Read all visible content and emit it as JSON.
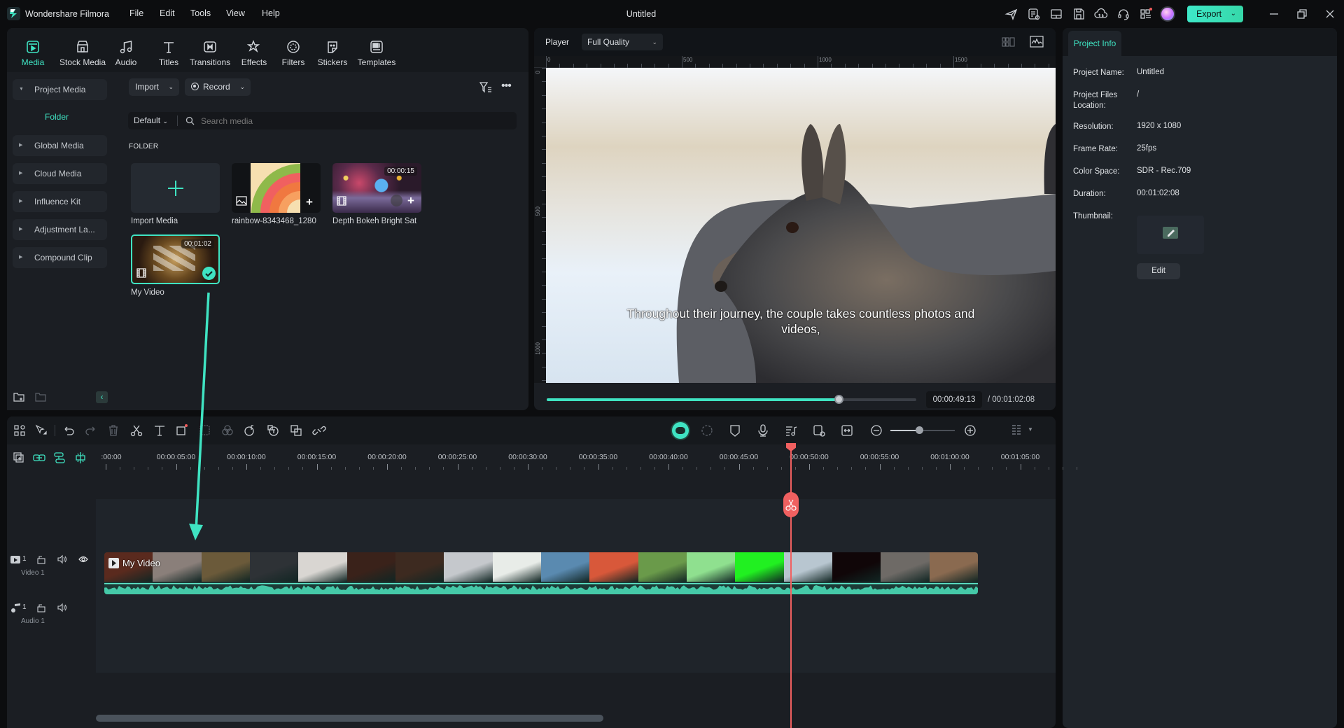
{
  "app": {
    "name": "Wondershare Filmora",
    "document_title": "Untitled",
    "menu": [
      "File",
      "Edit",
      "Tools",
      "View",
      "Help"
    ],
    "title_icons": [
      "send-feedback-icon",
      "task-list-icon",
      "layout-icon",
      "save-icon",
      "cloud-upload-icon",
      "support-headset-icon",
      "apps-grid-icon",
      "user-avatar"
    ],
    "export_label": "Export",
    "accent": "#3fe3c2",
    "playhead_color": "#f06060"
  },
  "media_tabs": [
    {
      "label": "Media",
      "icon": "media-icon",
      "active": true
    },
    {
      "label": "Stock Media",
      "icon": "stock-media-icon",
      "active": false
    },
    {
      "label": "Audio",
      "icon": "audio-icon",
      "active": false
    },
    {
      "label": "Titles",
      "icon": "titles-icon",
      "active": false
    },
    {
      "label": "Transitions",
      "icon": "transitions-icon",
      "active": false
    },
    {
      "label": "Effects",
      "icon": "effects-icon",
      "active": false
    },
    {
      "label": "Filters",
      "icon": "filters-icon",
      "active": false
    },
    {
      "label": "Stickers",
      "icon": "stickers-icon",
      "active": false
    },
    {
      "label": "Templates",
      "icon": "templates-icon",
      "active": false
    }
  ],
  "sidebar": {
    "items": [
      {
        "label": "Project Media",
        "expanded": true
      },
      {
        "label": "Global Media",
        "expanded": false
      },
      {
        "label": "Cloud Media",
        "expanded": false
      },
      {
        "label": "Influence Kit",
        "expanded": false
      },
      {
        "label": "Adjustment La...",
        "expanded": false
      },
      {
        "label": "Compound Clip",
        "expanded": false
      }
    ],
    "folder_label": "Folder"
  },
  "media": {
    "import_label": "Import",
    "record_label": "Record",
    "sort_label": "Default",
    "search_placeholder": "Search media",
    "section_header": "FOLDER",
    "items": [
      {
        "name": "Import Media",
        "type": "import"
      },
      {
        "name": "rainbow-8343468_1280",
        "type": "image"
      },
      {
        "name": "Depth Bokeh Bright Sat",
        "type": "video",
        "duration": "00:00:15"
      },
      {
        "name": "My Video",
        "type": "video",
        "duration": "00:01:02",
        "selected": true
      }
    ]
  },
  "player": {
    "label": "Player",
    "quality": "Full Quality",
    "ruler_h": [
      "0",
      "500",
      "1000",
      "1500"
    ],
    "ruler_v": [
      "0",
      "500",
      "1000"
    ],
    "subtitle_line1": "Throughout their journey, the couple takes countless photos and",
    "subtitle_line2": "videos,",
    "current_time": "00:00:49:13",
    "total_time": "/ 00:01:02:08",
    "progress": 0.79
  },
  "project_info": {
    "tab_label": "Project Info",
    "fields": [
      {
        "label": "Project Name:",
        "value": "Untitled"
      },
      {
        "label": "Project Files Location:",
        "value": "/"
      },
      {
        "label": "Resolution:",
        "value": "1920 x 1080"
      },
      {
        "label": "Frame Rate:",
        "value": "25fps"
      },
      {
        "label": "Color Space:",
        "value": "SDR - Rec.709"
      },
      {
        "label": "Duration:",
        "value": "00:01:02:08"
      },
      {
        "label": "Thumbnail:",
        "value": ""
      }
    ],
    "edit_label": "Edit"
  },
  "timeline": {
    "ruler_labels": [
      ":00:00",
      "00:00:05:00",
      "00:00:10:00",
      "00:00:15:00",
      "00:00:20:00",
      "00:00:25:00",
      "00:00:30:00",
      "00:00:35:00",
      "00:00:40:00",
      "00:00:45:00",
      "00:00:50:00",
      "00:00:55:00",
      "00:01:00:00",
      "00:01:05:00"
    ],
    "zoom_level": 0.45,
    "playhead_time": "00:00:49:13",
    "tracks": [
      {
        "name": "Video 1",
        "index": "1",
        "type": "video"
      },
      {
        "name": "Audio 1",
        "index": "1",
        "type": "audio"
      }
    ],
    "clip": {
      "name": "My Video"
    },
    "frame_colors": [
      "#5a2a1e",
      "#8a7f7a",
      "#6b5a3a",
      "#2e3236",
      "#d9d6d2",
      "#3a221a",
      "#3d2a20",
      "#c5c8cc",
      "#e8ece8",
      "#5a8ab0",
      "#d8583a",
      "#6a9a4a",
      "#8fe08f",
      "#21f021",
      "#b8c6d0",
      "#100608",
      "#6e6a66",
      "#8a6a50"
    ]
  }
}
